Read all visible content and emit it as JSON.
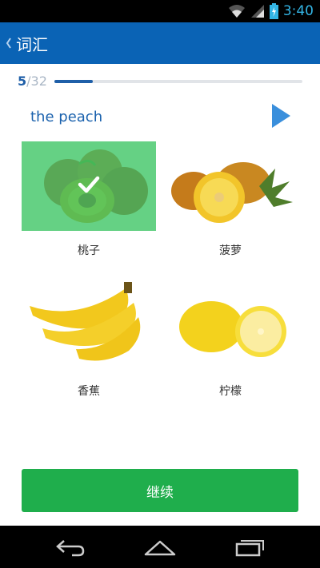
{
  "status_bar": {
    "time": "3:40",
    "icons": [
      "wifi-icon",
      "signal-icon",
      "battery-charging-icon"
    ]
  },
  "app_bar": {
    "title": "词汇",
    "back_icon": "chevron-left-icon",
    "background": "#0a63b5"
  },
  "progress": {
    "current": "5",
    "separator": "/",
    "total": "32",
    "fraction": 0.156
  },
  "question": {
    "word": "the peach",
    "play_icon": "play-icon"
  },
  "options": [
    {
      "label": "桃子",
      "image": "peach-image",
      "selected": true
    },
    {
      "label": "菠萝",
      "image": "pineapple-image",
      "selected": false
    },
    {
      "label": "香蕉",
      "image": "banana-image",
      "selected": false
    },
    {
      "label": "柠檬",
      "image": "lemon-image",
      "selected": false
    }
  ],
  "continue_button": {
    "label": "继续",
    "color": "#1fae4c"
  },
  "nav_bar": {
    "icons": [
      "back-icon",
      "home-icon",
      "recents-icon"
    ]
  }
}
